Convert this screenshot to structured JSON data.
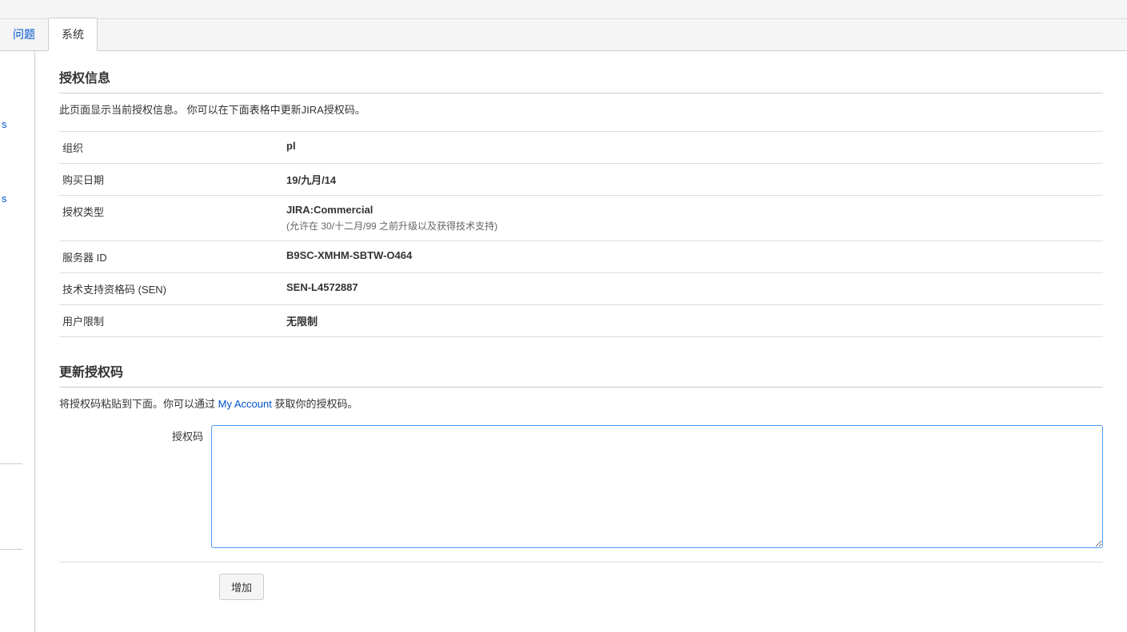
{
  "tabs": {
    "issues_label": "问题",
    "system_label": "系统"
  },
  "sidebar": {
    "item1": "s",
    "item2": "s"
  },
  "license_info": {
    "heading": "授权信息",
    "description": "此页面显示当前授权信息。 你可以在下面表格中更新JIRA授权码。",
    "rows": {
      "org_label": "组织",
      "org_value": "pl",
      "purchase_label": "购买日期",
      "purchase_value": "19/九月/14",
      "type_label": "授权类型",
      "type_value": "JIRA:Commercial",
      "type_note": "(允许在 30/十二月/99 之前升级以及获得技术支持)",
      "server_id_label": "服务器 ID",
      "server_id_value": "B9SC-XMHM-SBTW-O464",
      "sen_label": "技术支持资格码 (SEN)",
      "sen_value": "SEN-L4572887",
      "user_limit_label": "用户限制",
      "user_limit_value": "无限制"
    }
  },
  "update_license": {
    "heading": "更新授权码",
    "desc_prefix": "将授权码粘贴到下面。你可以通过 ",
    "desc_link": "My Account",
    "desc_suffix": " 获取你的授权码。",
    "field_label": "授权码",
    "textarea_value": "",
    "submit_label": "增加"
  }
}
